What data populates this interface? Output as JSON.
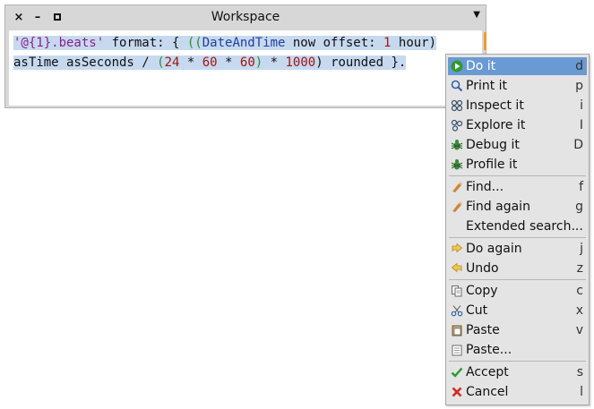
{
  "window": {
    "title": "Workspace",
    "close_glyph": "×",
    "minimize_glyph": "–",
    "menu_glyph": "▼"
  },
  "editor": {
    "line1": {
      "s1": "'@{1}.beats'",
      "s2": " format: { ",
      "s3": "((",
      "s4": "DateAndTime",
      "s5": " now offset: ",
      "s6": "1",
      "s7": " hour)"
    },
    "line2": {
      "s1": "asTime asSeconds / ",
      "s2": "(",
      "s3": "24",
      "s4": " * ",
      "s5": "60",
      "s6": " * ",
      "s7": "60",
      "s8": ")",
      "s9": " * ",
      "s10": "1000",
      "s11": ") rounded }."
    }
  },
  "context_menu": {
    "items": [
      {
        "label": "Do it",
        "shortcut": "d",
        "icon": "play-icon",
        "highlighted": true
      },
      {
        "label": "Print it",
        "shortcut": "p",
        "icon": "print-icon"
      },
      {
        "label": "Inspect it",
        "shortcut": "i",
        "icon": "inspect-icon"
      },
      {
        "label": "Explore it",
        "shortcut": "I",
        "icon": "explore-icon"
      },
      {
        "label": "Debug it",
        "shortcut": "D",
        "icon": "debug-icon"
      },
      {
        "label": "Profile it",
        "shortcut": "",
        "icon": "profile-icon"
      },
      {
        "label": "Find...",
        "shortcut": "f",
        "icon": "find-icon"
      },
      {
        "label": "Find again",
        "shortcut": "g",
        "icon": "find-again-icon"
      },
      {
        "label": "Extended search...",
        "shortcut": "",
        "icon": ""
      },
      {
        "label": "Do again",
        "shortcut": "j",
        "icon": "redo-icon"
      },
      {
        "label": "Undo",
        "shortcut": "z",
        "icon": "undo-icon"
      },
      {
        "label": "Copy",
        "shortcut": "c",
        "icon": "copy-icon"
      },
      {
        "label": "Cut",
        "shortcut": "x",
        "icon": "cut-icon"
      },
      {
        "label": "Paste",
        "shortcut": "v",
        "icon": "paste-icon"
      },
      {
        "label": "Paste...",
        "shortcut": "",
        "icon": "paste-list-icon"
      },
      {
        "label": "Accept",
        "shortcut": "s",
        "icon": "accept-icon"
      },
      {
        "label": "Cancel",
        "shortcut": "l",
        "icon": "cancel-icon"
      }
    ]
  },
  "colors": {
    "selection": "#c6d9ef",
    "menu_highlight": "#6a9ad4",
    "string": "#8b1f8b",
    "class": "#1f3fa0",
    "number": "#a11414"
  }
}
